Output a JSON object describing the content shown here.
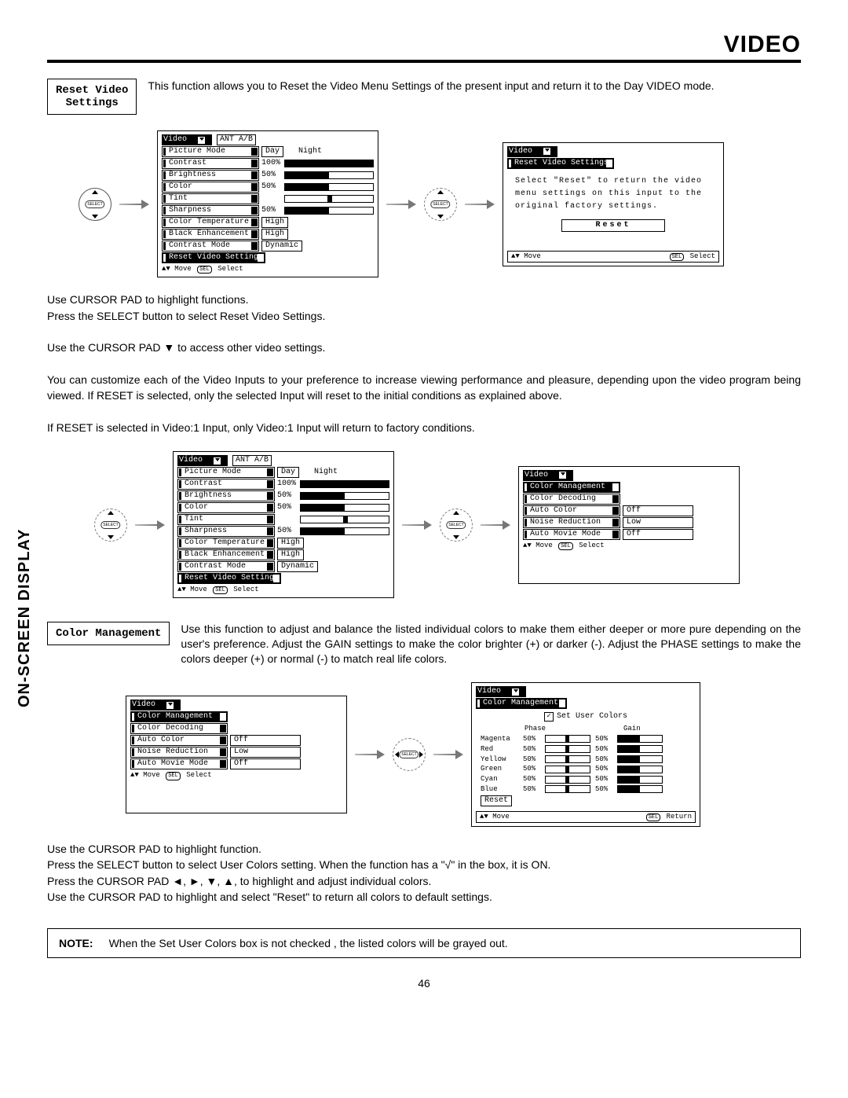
{
  "page_title": "VIDEO",
  "vertical_label": "ON-SCREEN DISPLAY",
  "page_number": "46",
  "reset_section": {
    "label_line1": "Reset Video",
    "label_line2": "Settings",
    "text": "This function allows you to Reset the Video Menu Settings of the present input and return it to the Day VIDEO mode."
  },
  "body1": "Use CURSOR PAD to highlight functions.",
  "body2": "Press the SELECT button to select Reset Video Settings.",
  "body3": "Use the CURSOR PAD ▼ to access other video settings.",
  "body4": "You can customize each of the Video Inputs to your preference to increase viewing performance and pleasure, depending upon the video program being viewed. If RESET is selected, only the selected Input will reset to the initial conditions as explained above.",
  "body5": "If RESET is selected in Video:1 Input, only Video:1 Input will return to factory conditions.",
  "color_section": {
    "label": "Color Management",
    "text": "Use this function to adjust and balance the listed individual colors to make them either deeper or more pure depending on the user's preference.  Adjust the GAIN settings to make the color brighter (+) or darker (-).  Adjust the PHASE settings to make the colors deeper (+) or normal (-) to match real life colors."
  },
  "instr1": "Use the CURSOR PAD to highlight function.",
  "instr2": "Press the SELECT button to select User Colors setting.  When the function has a \"√\" in the box, it is ON.",
  "instr3": "Press  the CURSOR PAD ◄, ►, ▼, ▲, to highlight and adjust individual colors.",
  "instr4": "Use  the CURSOR PAD to highlight and select \"Reset\" to return all colors to default settings.",
  "note_label": "NOTE:",
  "note_text": "When the Set User Colors box is not checked , the listed colors will be grayed out.",
  "osd_video": {
    "title": "Video",
    "ant": "ANT A/B",
    "picture_mode": "Picture Mode",
    "day": "Day",
    "night": "Night",
    "contrast": "Contrast",
    "contrast_val": "100%",
    "brightness": "Brightness",
    "brightness_val": "50%",
    "color": "Color",
    "color_val": "50%",
    "tint": "Tint",
    "sharpness": "Sharpness",
    "sharpness_val": "50%",
    "color_temp": "Color Temperature",
    "color_temp_val": "High",
    "black_enh": "Black Enhancement",
    "black_enh_val": "High",
    "contrast_mode": "Contrast Mode",
    "contrast_mode_val": "Dynamic",
    "reset": "Reset Video Settings",
    "foot_move": "Move",
    "foot_select": "Select"
  },
  "osd_reset": {
    "title": "Video",
    "sub": "Reset Video Settings",
    "msg1": "Select \"Reset\" to return the video",
    "msg2": "menu settings on this input to the",
    "msg3": "original factory settings.",
    "btn": "Reset",
    "foot_move": "Move",
    "foot_select": "Select"
  },
  "osd_cm_list": {
    "title": "Video",
    "cm": "Color Management",
    "decode": "Color Decoding",
    "auto_color": "Auto Color",
    "auto_color_val": "Off",
    "noise": "Noise Reduction",
    "noise_val": "Low",
    "auto_movie": "Auto Movie Mode",
    "auto_movie_val": "Off"
  },
  "osd_cm_detail": {
    "title": "Video",
    "cm": "Color Management",
    "set_user": "Set User Colors",
    "phase": "Phase",
    "gain": "Gain",
    "colors": [
      "Magenta",
      "Red",
      "Yellow",
      "Green",
      "Cyan",
      "Blue"
    ],
    "val": "50%",
    "reset": "Reset",
    "foot_move": "Move",
    "foot_return": "Return"
  },
  "sel_label": "SEL",
  "select_inner": "SELECT"
}
